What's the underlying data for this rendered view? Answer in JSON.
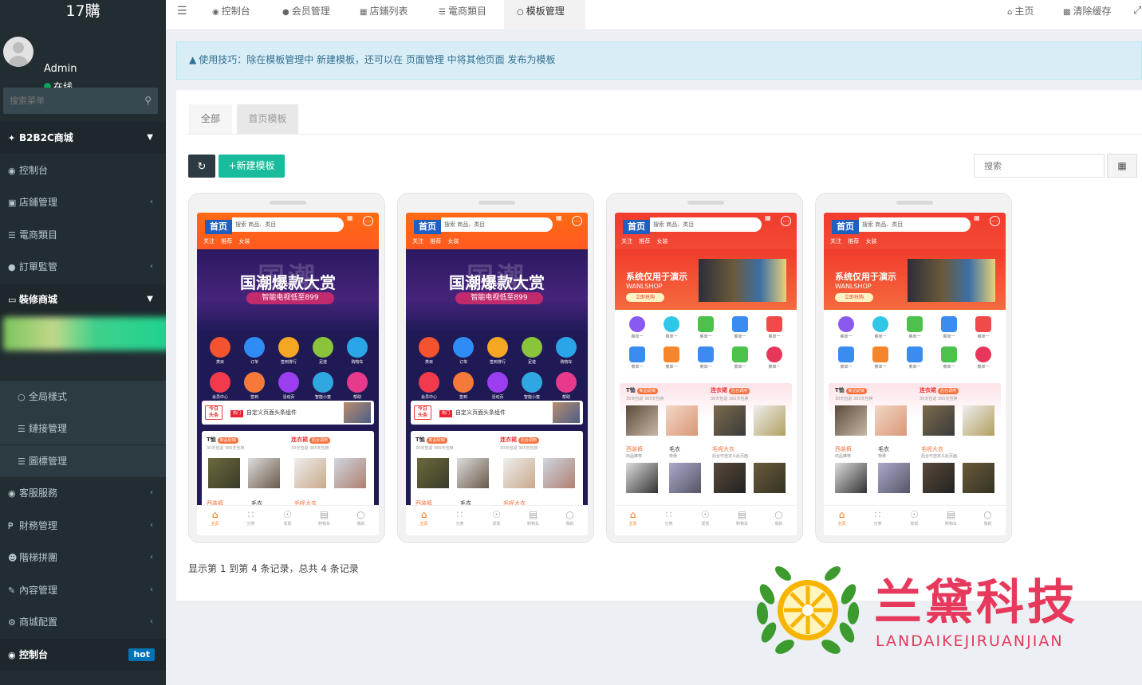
{
  "app": {
    "title": "17購"
  },
  "user": {
    "name": "Admin",
    "status": "在线"
  },
  "sidebar": {
    "search_placeholder": "搜索菜单",
    "items": [
      {
        "label": "B2B2C商城",
        "icon": "magic-wand-icon"
      },
      {
        "label": "控制台",
        "icon": "dashboard-icon"
      },
      {
        "label": "店鋪管理",
        "icon": "store-icon"
      },
      {
        "label": "電商類目",
        "icon": "list-icon"
      },
      {
        "label": "訂單監管",
        "icon": "order-icon"
      },
      {
        "label": "裝修商城",
        "icon": "desktop-icon"
      },
      {
        "label": "全局樣式",
        "icon": "circle-icon"
      },
      {
        "label": "鏈接管理",
        "icon": "list-icon"
      },
      {
        "label": "圖標管理",
        "icon": "list-icon"
      },
      {
        "label": "客服服務",
        "icon": "chat-icon"
      },
      {
        "label": "財務管理",
        "icon": "money-icon"
      },
      {
        "label": "階梯拼團",
        "icon": "group-icon"
      },
      {
        "label": "內容管理",
        "icon": "edit-icon"
      },
      {
        "label": "商城配置",
        "icon": "gear-icon"
      },
      {
        "label": "控制台",
        "icon": "dashboard-icon",
        "badge": "hot"
      }
    ]
  },
  "topnav": {
    "toggle_icon": "menu-toggle-icon",
    "tabs": [
      {
        "label": "控制台",
        "icon": "dashboard-icon"
      },
      {
        "label": "会员管理",
        "icon": "user-icon"
      },
      {
        "label": "店鋪列表",
        "icon": "table-icon"
      },
      {
        "label": "電商類目",
        "icon": "list-icon"
      },
      {
        "label": "模板管理",
        "icon": "circle-icon",
        "active": true
      }
    ],
    "right": [
      {
        "label": "主页",
        "icon": "home-icon"
      },
      {
        "label": "清除缓存",
        "icon": "trash-icon"
      }
    ]
  },
  "alert": {
    "text": "使用技巧：除在模板管理中 新建模板，还可以在 页面管理 中将其他页面 发布为模板"
  },
  "tabs": [
    {
      "label": "全部",
      "active": true
    },
    {
      "label": "首页模板"
    }
  ],
  "toolbar": {
    "add_label": "新建模板",
    "search_placeholder": "搜索"
  },
  "templates": [
    {
      "header_bg": "orange",
      "title": "首页",
      "search": "搜索 商品、类目",
      "tabs": "关注 推荐 女装",
      "banner": {
        "style": "dark",
        "title": "国潮爆款大赏",
        "subtitle": "智能电视低至899",
        "bg_text": "国潮"
      },
      "icons": [
        [
          "类目",
          "订单",
          "签到排行",
          "足迹",
          "购物车"
        ],
        [
          "会员中心",
          "签到",
          "活动页",
          "智能小蜜",
          "帮助"
        ]
      ],
      "news": {
        "badge": "热门",
        "text": "自定义页面头条组件"
      },
      "goods": [
        {
          "title": "T恤",
          "tag": "新品促销",
          "sub": "30天包退 365天包换"
        },
        {
          "title": "连衣裙",
          "tag": "后台调用",
          "sub": "30天包退 365天包换"
        }
      ],
      "goods2": [
        "西装裤",
        "毛衣",
        "毛呢大衣"
      ],
      "footer": [
        "主页",
        "分类",
        "发现",
        "购物车",
        "我的"
      ]
    },
    {
      "header_bg": "orange",
      "title": "首页",
      "search": "搜索 商品、类目",
      "tabs": "关注 推荐 女装",
      "banner": {
        "style": "dark",
        "title": "国潮爆款大赏",
        "subtitle": "智能电视低至899",
        "bg_text": "国潮"
      },
      "icons": [
        [
          "类目",
          "订单",
          "签到排行",
          "足迹",
          "购物车"
        ],
        [
          "会员中心",
          "签到",
          "活动页",
          "智能小蜜",
          "帮助"
        ]
      ],
      "news": {
        "badge": "热门",
        "text": "自定义页面头条组件"
      },
      "goods": [
        {
          "title": "T恤",
          "tag": "新品促销",
          "sub": "30天包退 365天包换"
        },
        {
          "title": "连衣裙",
          "tag": "后台调用",
          "sub": "30天包退 365天包换"
        }
      ],
      "goods2": [
        "西装裤",
        "毛衣",
        "毛呢大衣"
      ],
      "footer": [
        "主页",
        "分类",
        "发现",
        "购物车",
        "我的"
      ]
    },
    {
      "header_bg": "red",
      "title": "首页",
      "search": "搜索 商品、类目",
      "tabs": "关注 推荐 女装",
      "banner": {
        "style": "red",
        "title": "系统仅用于演示",
        "subtitle": "WANLSHOP",
        "button": "立即抢购"
      },
      "icons": [
        [
          "菜单一",
          "菜单一",
          "菜单一",
          "菜单一",
          "菜单一"
        ],
        [
          "菜单一",
          "菜单一",
          "菜单一",
          "菜单一",
          "菜单一"
        ]
      ],
      "goods": [
        {
          "title": "T恤",
          "tag": "新品促销",
          "sub": "30天包退 365天包换"
        },
        {
          "title": "连衣裙",
          "tag": "后台调用",
          "sub": "30天包退 365天包换"
        }
      ],
      "goods2": [
        {
          "title": "西装裤",
          "sub": "商品推荐"
        },
        {
          "title": "毛衣",
          "sub": "特惠"
        },
        {
          "title": "毛呢大衣",
          "sub": "后台可自定义此页面"
        }
      ],
      "footer": [
        "主页",
        "分类",
        "发现",
        "购物车",
        "我的"
      ]
    },
    {
      "header_bg": "red",
      "title": "首页",
      "search": "搜索 商品、类目",
      "tabs": "关注 推荐 女装",
      "banner": {
        "style": "red",
        "title": "系统仅用于演示",
        "subtitle": "WANLSHOP",
        "button": "立即抢购"
      },
      "icons": [
        [
          "菜单一",
          "菜单一",
          "菜单一",
          "菜单一",
          "菜单一"
        ],
        [
          "菜单一",
          "菜单一",
          "菜单一",
          "菜单一",
          "菜单一"
        ]
      ],
      "goods": [
        {
          "title": "T恤",
          "tag": "新品促销",
          "sub": "30天包退 365天包换"
        },
        {
          "title": "连衣裙",
          "tag": "后台调用",
          "sub": "30天包退 365天包换"
        }
      ],
      "goods2": [
        {
          "title": "西装裤",
          "sub": "商品推荐"
        },
        {
          "title": "毛衣",
          "sub": "特惠"
        },
        {
          "title": "毛呢大衣",
          "sub": "后台可自定义此页面"
        }
      ],
      "footer": [
        "主页",
        "分类",
        "发现",
        "购物车",
        "我的"
      ]
    }
  ],
  "pagination": {
    "text": "显示第 1 到第 4 条记录，总共 4 条记录"
  },
  "watermark": {
    "text": "兰黛科技",
    "subtext": "LANDAIKEJIRUANJIAN"
  },
  "colors": {
    "sidebar": "#222d32",
    "accent": "#18bc9c",
    "alert_bg": "#d9edf7",
    "watermark": "#e7395b",
    "badge": "#0073b7"
  }
}
